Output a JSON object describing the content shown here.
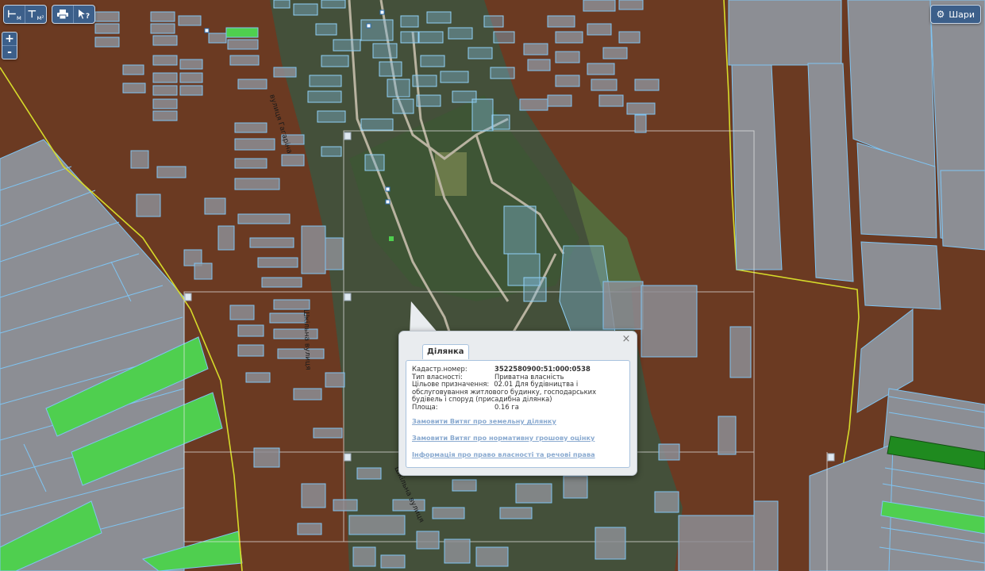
{
  "colors": {
    "farmland": "#6b3a22",
    "parcel_fill": "#8c8e94",
    "parcel_stroke": "#7fc4f2",
    "boundary": "#d6db2a",
    "selected_green": "#4fcf4f",
    "dark_green": "#1f8a1f",
    "village_satellite": "#44503a"
  },
  "toolbar": {
    "measure_line_label": "м",
    "measure_area_label": "м²",
    "print_icon": "printer-icon",
    "identify_label": "?"
  },
  "zoom": {
    "in_label": "+",
    "out_label": "-"
  },
  "layers_button": {
    "label": "Шари",
    "icon": "gear-icon"
  },
  "street_labels": [
    "вулиця Гагаріна",
    "Шкільна вулиця",
    "Шкільна вулиця"
  ],
  "popup": {
    "tab_label": "Ділянка",
    "close_label": "×",
    "cadastral_label": "Кадастр.номер:",
    "cadastral_value": "3522580900:51:000:0538",
    "ownership_label": "Тип власності:",
    "ownership_value": "Приватна власність",
    "purpose_label": "Цільове призначення:",
    "purpose_value": "02.01 Для будівництва і",
    "purpose_value_cont": "обслуговування житлового будинку, господарських будівель і споруд (присадибна ділянка)",
    "area_label": "Площа:",
    "area_value": "0.16 га",
    "links": [
      "Замовити Витяг про земельну ділянку",
      "Замовити Витяг про нормативну грошову оцінку",
      "Інформація про право власності та речові права"
    ]
  }
}
